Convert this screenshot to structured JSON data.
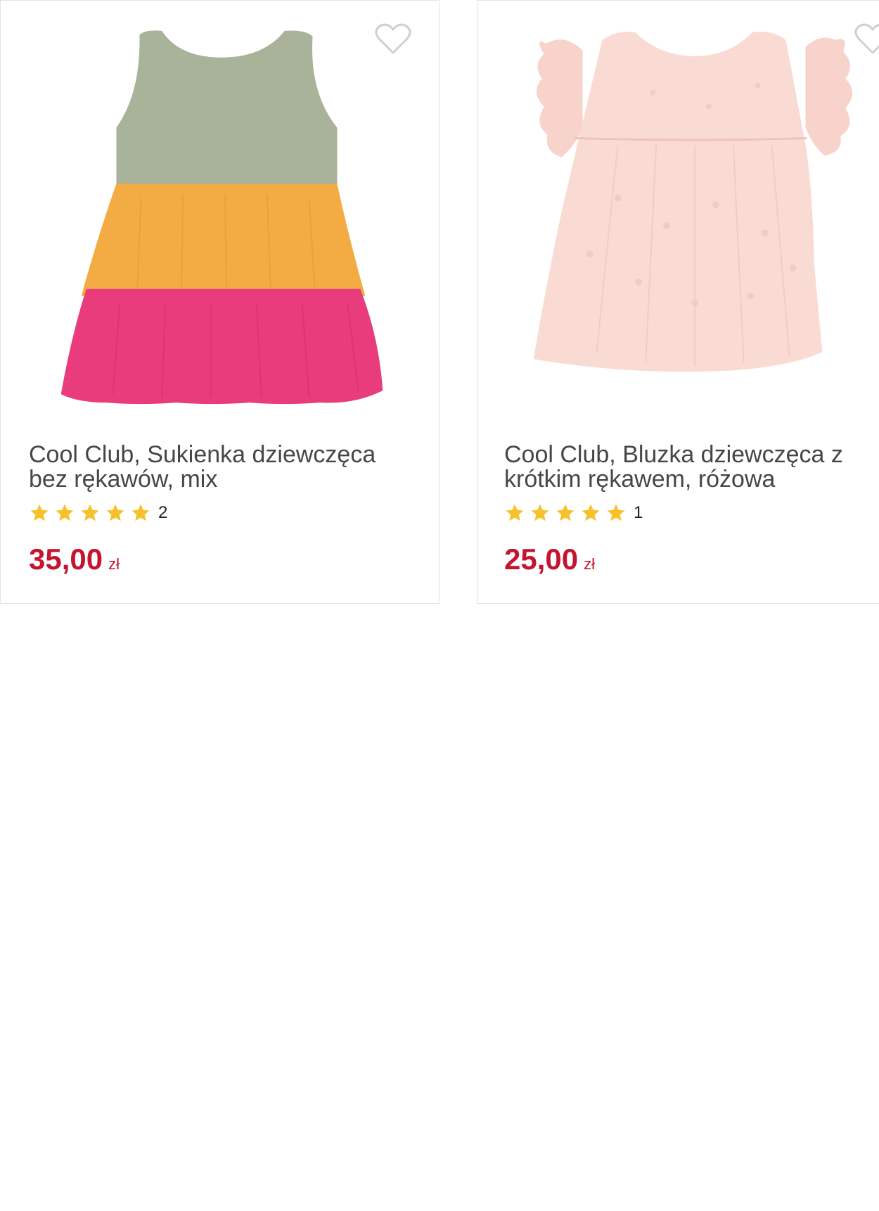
{
  "products": [
    {
      "title": "Cool Club, Sukienka dziewczęca bez rękawów, mix",
      "rating_count": "2",
      "rating_stars": 5,
      "price": "35,00",
      "currency": "zł",
      "image": "tiered-sleeveless-dress-sage-orange-pink"
    },
    {
      "title": "Cool Club, Bluzka dziewczęca z krótkim rękawem, różowa",
      "rating_count": "1",
      "rating_stars": 5,
      "price": "25,00",
      "currency": "zł",
      "image": "pink-ruffle-sleeve-blouse"
    }
  ],
  "colors": {
    "price": "#c5142f",
    "star": "#f6c12b",
    "title": "#464646",
    "card_border": "#e3e3e3",
    "heart_outline": "#cfcfcf"
  }
}
